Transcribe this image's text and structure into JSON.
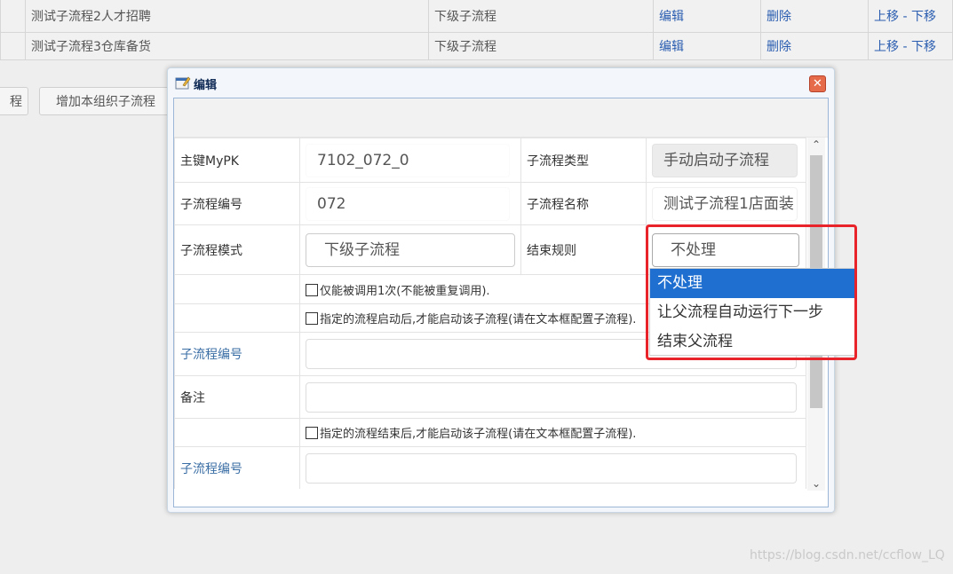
{
  "background": {
    "rows": [
      {
        "name": "测试子流程2人才招聘",
        "mode": "下级子流程",
        "edit": "编辑",
        "delete": "删除",
        "up": "上移",
        "sep": "-",
        "down": "下移"
      },
      {
        "name": "测试子流程3仓库备货",
        "mode": "下级子流程",
        "edit": "编辑",
        "delete": "删除",
        "up": "上移",
        "sep": "-",
        "down": "下移"
      }
    ],
    "btn_left": "程",
    "btn_add": "增加本组织子流程"
  },
  "dialog": {
    "title": "编辑",
    "close_glyph": "✕",
    "fields": {
      "mypk_label": "主键MyPK",
      "mypk_value": "7102_072_0",
      "type_label": "子流程类型",
      "type_value": "手动启动子流程",
      "no_label": "子流程编号",
      "no_value": "072",
      "name_label": "子流程名称",
      "name_value": "测试子流程1店面装",
      "mode_label": "子流程模式",
      "mode_value": "下级子流程",
      "rule_label": "结束规则",
      "rule_value": "不处理",
      "once_text": "仅能被调用1次(不能被重复调用).",
      "start_text": "指定的流程启动后,才能启动该子流程(请在文本框配置子流程).",
      "sub_no_label1": "子流程编号",
      "remark_label": "备注",
      "end_text": "指定的流程结束后,才能启动该子流程(请在文本框配置子流程).",
      "sub_no_label2": "子流程编号"
    }
  },
  "dropdown": {
    "options": [
      "不处理",
      "让父流程自动运行下一步",
      "结束父流程"
    ],
    "selected": "不处理"
  },
  "watermark": "https://blog.csdn.net/ccflow_LQ",
  "colors": {
    "link": "#2a5db0",
    "highlight": "#1e6fd0",
    "annotation": "#e8232a",
    "close": "#e66b4a"
  }
}
